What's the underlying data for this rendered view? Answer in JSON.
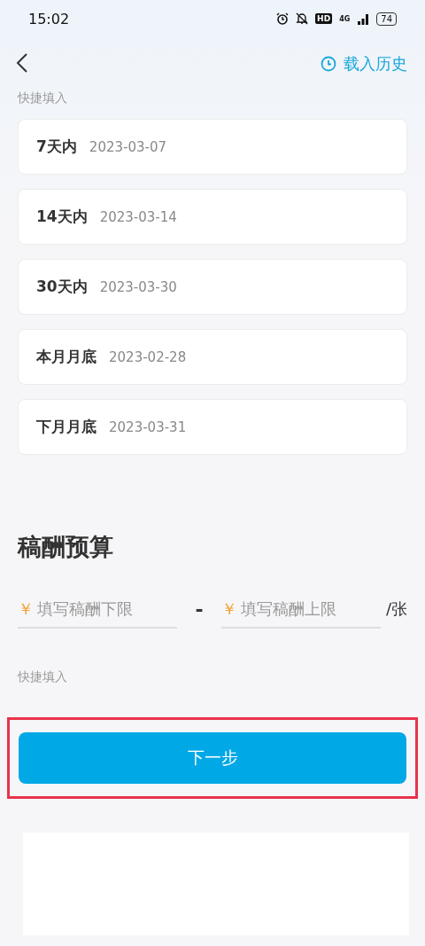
{
  "status_bar": {
    "time": "15:02",
    "hd": "HD",
    "network": "4G",
    "battery": "74"
  },
  "header": {
    "history_link": "载入历史"
  },
  "quick_fill_label": "快捷填入",
  "date_options": [
    {
      "label": "7天内",
      "date": "2023-03-07"
    },
    {
      "label": "14天内",
      "date": "2023-03-14"
    },
    {
      "label": "30天内",
      "date": "2023-03-30"
    },
    {
      "label": "本月月底",
      "date": "2023-02-28"
    },
    {
      "label": "下月月底",
      "date": "2023-03-31"
    }
  ],
  "budget": {
    "title": "稿酬预算",
    "currency": "￥",
    "min_placeholder": "填写稿酬下限",
    "separator": "-",
    "max_placeholder": "填写稿酬上限",
    "unit": "/张",
    "quick_fill_label": "快捷填入"
  },
  "next_button": {
    "label": "下一步",
    "highlighted": true
  }
}
